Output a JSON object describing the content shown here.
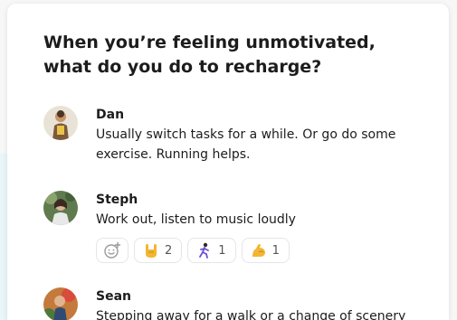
{
  "thread": {
    "question": "When you’re feeling unmotivated, what do you do to recharge?",
    "messages": [
      {
        "author": "Dan",
        "text": "Usually switch tasks for a while. Or go do some exercise. Running helps.",
        "avatar_icon": "user-avatar-dan"
      },
      {
        "author": "Steph",
        "text": "Work out, listen to music loudly",
        "avatar_icon": "user-avatar-steph",
        "reactions": [
          {
            "icon": "rock-on-hand-emoji",
            "count": "2"
          },
          {
            "icon": "runner-emoji",
            "count": "1"
          },
          {
            "icon": "flexed-biceps-emoji",
            "count": "1"
          }
        ]
      },
      {
        "author": "Sean",
        "text": "Stepping away for a walk or a change of scenery",
        "avatar_icon": "user-avatar-sean"
      }
    ]
  },
  "colors": {
    "background": "#f7f7f7",
    "card": "#ffffff",
    "text": "#1d1c1d",
    "accent_backdrop": "#e8f5f9",
    "reaction_border": "#e6e6e6"
  }
}
